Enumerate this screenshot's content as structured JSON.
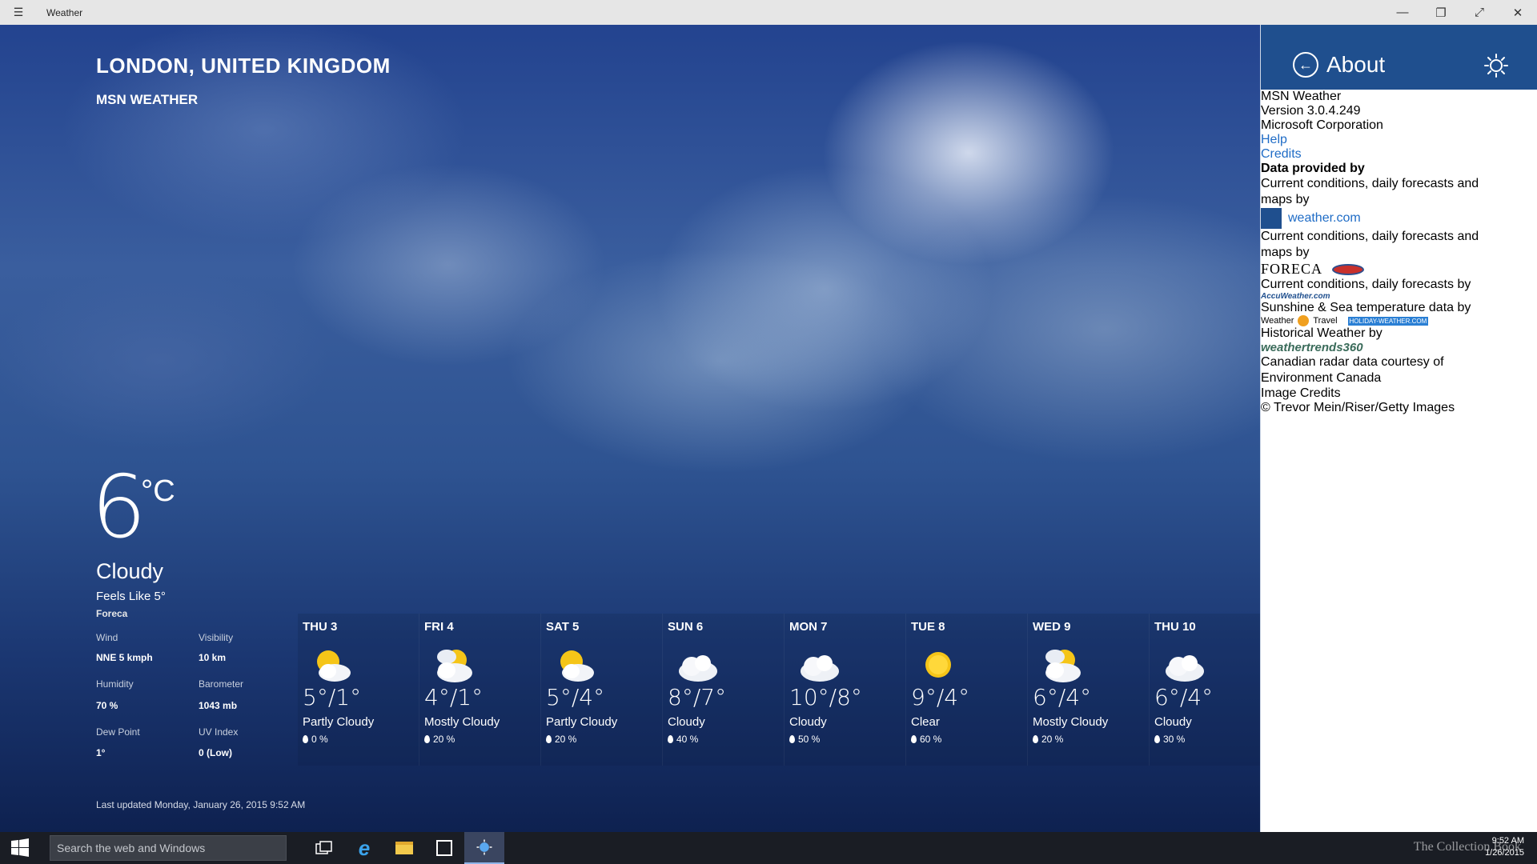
{
  "window": {
    "title": "Weather",
    "controls": [
      "minimize",
      "restore",
      "fullscreen",
      "close"
    ]
  },
  "location": {
    "name": "LONDON, UNITED KINGDOM",
    "provider": "MSN WEATHER"
  },
  "current": {
    "temperature": "6",
    "unit": "°C",
    "condition": "Cloudy",
    "feels_like": "Feels Like 5°",
    "source": "Foreca",
    "details": [
      {
        "label": "Wind",
        "value": "NNE 5 kmph"
      },
      {
        "label": "Visibility",
        "value": "10 km"
      },
      {
        "label": "Humidity",
        "value": "70 %"
      },
      {
        "label": "Barometer",
        "value": "1043 mb"
      },
      {
        "label": "Dew Point",
        "value": "1°"
      },
      {
        "label": "UV Index",
        "value": "0 (Low)"
      }
    ]
  },
  "forecast": [
    {
      "day": "THU 3",
      "temp": "5°/1°",
      "condition": "Partly Cloudy",
      "precip": "0 %",
      "icon": "partly-cloudy-icon"
    },
    {
      "day": "FRI 4",
      "temp": "4°/1°",
      "condition": "Mostly Cloudy",
      "precip": "20 %",
      "icon": "mostly-cloudy-icon"
    },
    {
      "day": "SAT 5",
      "temp": "5°/4°",
      "condition": "Partly Cloudy",
      "precip": "20 %",
      "icon": "partly-cloudy-icon"
    },
    {
      "day": "SUN 6",
      "temp": "8°/7°",
      "condition": "Cloudy",
      "precip": "40 %",
      "icon": "cloudy-icon"
    },
    {
      "day": "MON 7",
      "temp": "10°/8°",
      "condition": "Cloudy",
      "precip": "50 %",
      "icon": "cloudy-icon"
    },
    {
      "day": "TUE 8",
      "temp": "9°/4°",
      "condition": "Clear",
      "precip": "60 %",
      "icon": "sun-icon"
    },
    {
      "day": "WED 9",
      "temp": "6°/4°",
      "condition": "Mostly Cloudy",
      "precip": "20 %",
      "icon": "mostly-cloudy-icon"
    },
    {
      "day": "THU 10",
      "temp": "6°/4°",
      "condition": "Cloudy",
      "precip": "30 %",
      "icon": "cloudy-icon"
    }
  ],
  "last_updated": "Last updated Monday, January 26, 2015 9:52 AM",
  "about": {
    "title": "About",
    "app_name": "MSN Weather",
    "version": "Version 3.0.4.249",
    "company": "Microsoft Corporation",
    "help": "Help",
    "credits": "Credits",
    "data_provided_by": "Data provided by",
    "providers": [
      {
        "text": "Current conditions, daily forecasts and maps by",
        "link": "weather.com"
      },
      {
        "text": "Current conditions, daily forecasts and maps by",
        "logo": "FORECA"
      },
      {
        "text": "Current conditions, daily forecasts by",
        "logo": "AccuWeather.com"
      },
      {
        "text": "Sunshine & Sea temperature data by",
        "logo_a": "Weather",
        "logo_b": "Travel",
        "logo_c": "HOLIDAY-WEATHER.COM"
      },
      {
        "text": "Historical Weather by",
        "logo": "weathertrends360"
      }
    ],
    "radar": "Canadian radar data courtesy of Environment Canada",
    "image_credits_label": "Image Credits",
    "image_credits": "© Trevor Mein/Riser/Getty Images"
  },
  "taskbar": {
    "search_placeholder": "Search the web and Windows",
    "time": "9:52 AM",
    "date": "1/26/2015",
    "watermark": "The Collection Book"
  }
}
